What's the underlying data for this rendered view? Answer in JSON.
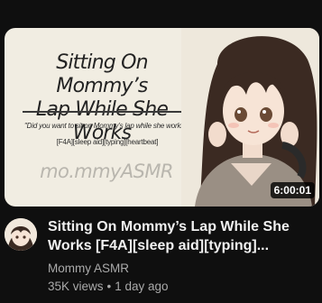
{
  "thumbnail": {
    "title_text": "Sitting On Mommy’s\nLap While She Works",
    "quote": "\"Did you want to sit on Mommy’s lap while she works?\"",
    "tags": "[F4A][sleep aid][typing][heartbeat]",
    "brand": "mo.mmyASMR",
    "duration": "6:00:01"
  },
  "video": {
    "title": "Sitting On Mommy’s Lap While She Works [F4A][sleep aid][typing]...",
    "channel": "Mommy ASMR",
    "views": "35K views",
    "separator": "•",
    "age": "1 day ago"
  },
  "icons": {
    "avatar": "channel-avatar-anime-girl"
  }
}
